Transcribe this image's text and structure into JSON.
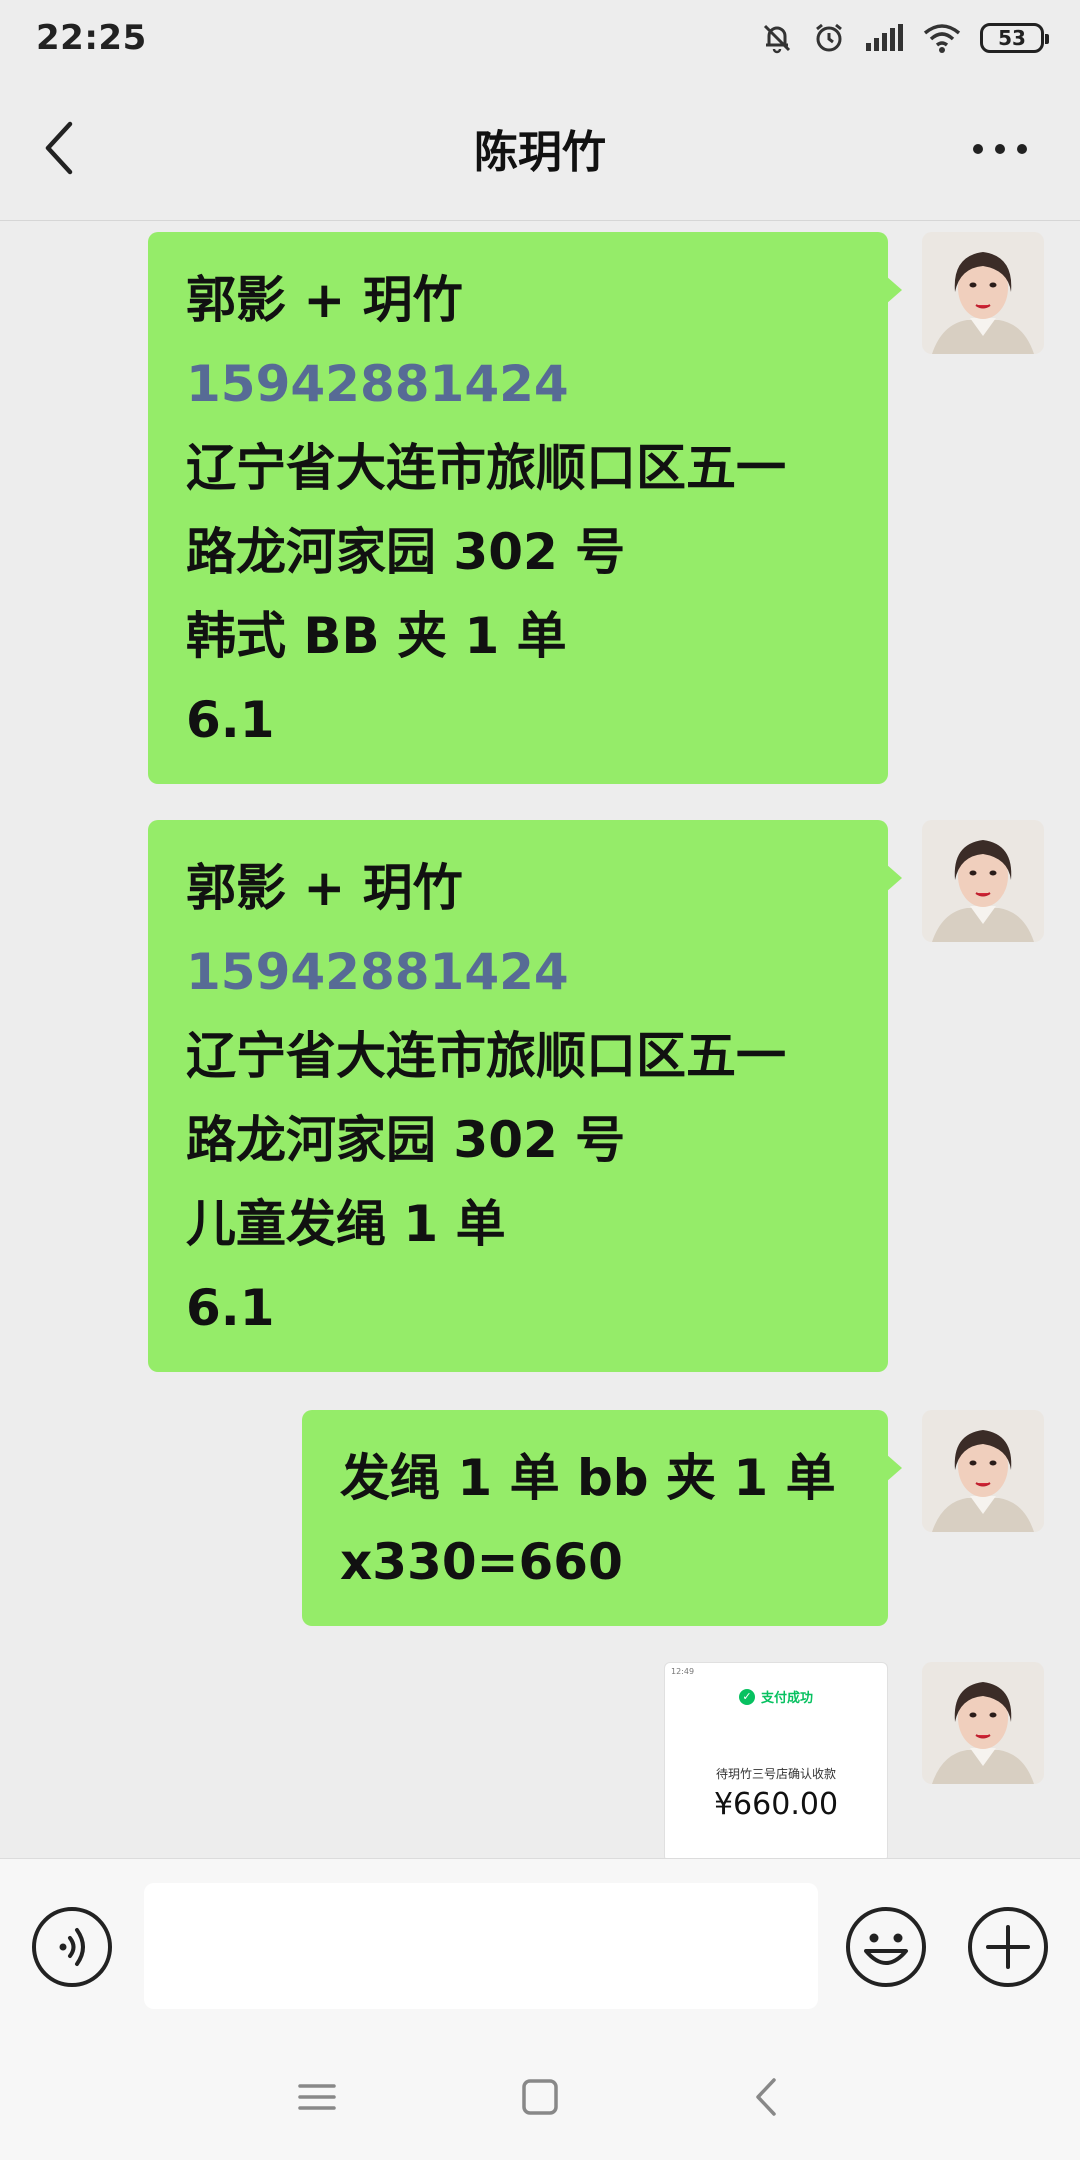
{
  "status_bar": {
    "time": "22:25",
    "battery": "53",
    "icons": [
      "mute-bell-icon",
      "alarm-icon",
      "signal-icon",
      "wifi-icon",
      "battery-icon"
    ]
  },
  "header": {
    "title": "陈玥竹",
    "back_icon": "chevron-left-icon",
    "more_icon": "more-dots-icon"
  },
  "messages": [
    {
      "type": "text",
      "sender": "self",
      "lines": [
        "郭影 + 玥竹",
        "15942881424",
        "辽宁省大连市旅顺口区五一",
        "路龙河家园 302 号",
        "韩式 BB 夹 1 单",
        "6.1"
      ]
    },
    {
      "type": "text",
      "sender": "self",
      "lines": [
        "郭影 + 玥竹",
        "15942881424",
        "辽宁省大连市旅顺口区五一",
        "路龙河家园 302 号",
        "儿童发绳 1 单",
        "6.1"
      ]
    },
    {
      "type": "text",
      "sender": "self",
      "lines": [
        "发绳 1 单 bb 夹 1 单",
        "x330=660"
      ]
    },
    {
      "type": "image",
      "sender": "self",
      "image": {
        "mini_time": "12:49",
        "pay_status": "支付成功",
        "pending_text": "待玥竹三号店确认收款",
        "amount": "¥660.00"
      }
    }
  ],
  "input_bar": {
    "placeholder": "",
    "voice_icon": "voice-icon",
    "emoji_icon": "emoji-icon",
    "plus_icon": "plus-icon"
  },
  "nav_bar": {
    "icons": [
      "menu-icon",
      "home-square-icon",
      "back-triangle-icon"
    ]
  },
  "colors": {
    "background": "#ededed",
    "bubble": "#95ec69",
    "phone_link": "#576b95"
  }
}
